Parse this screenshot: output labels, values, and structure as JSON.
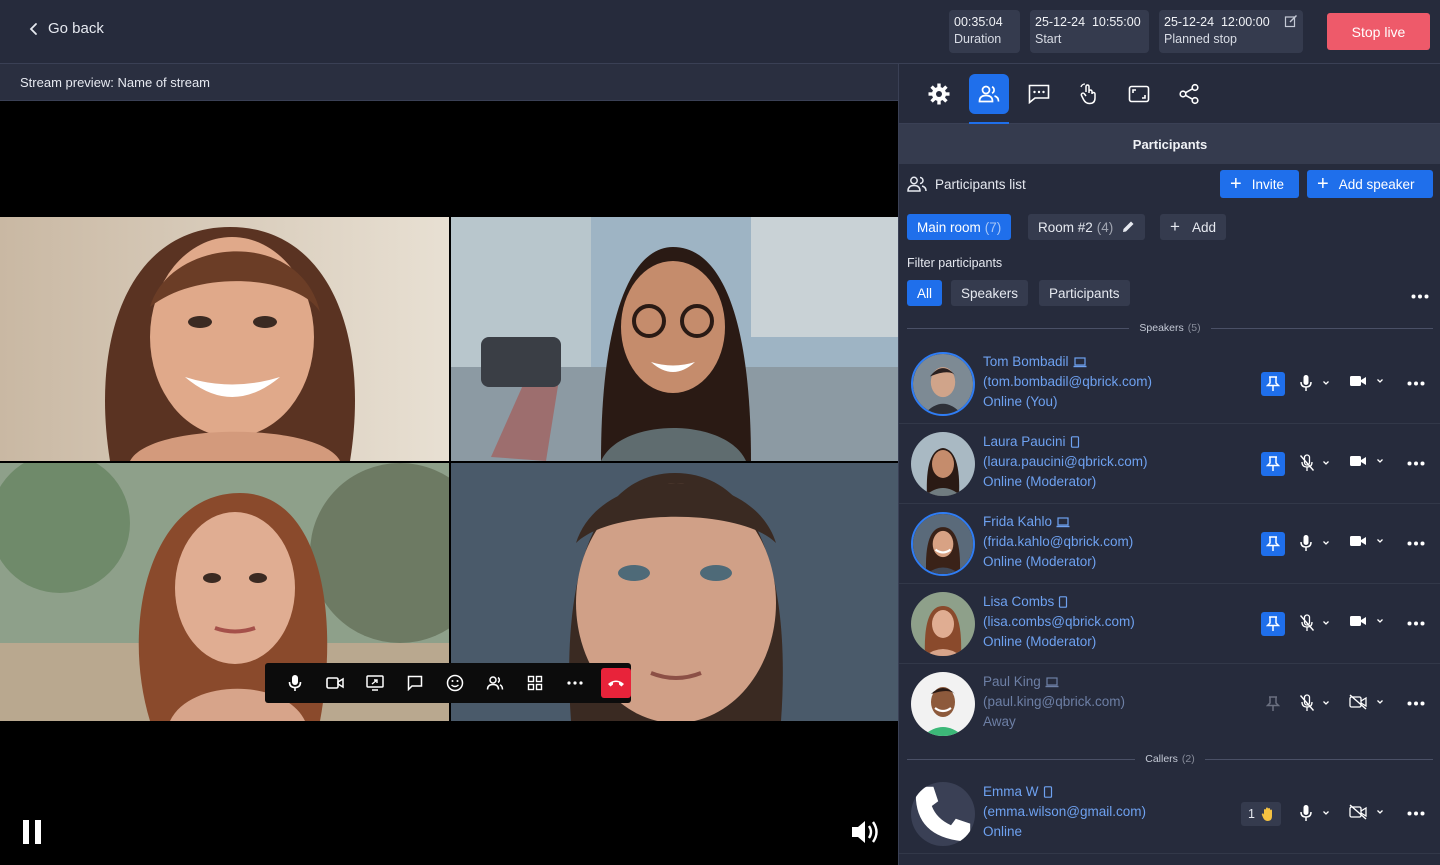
{
  "header": {
    "back_label": "Go back",
    "duration_value": "00:35:04",
    "duration_label": "Duration",
    "start_value": "25-12-24  10:55:00",
    "start_label": "Start",
    "planned_value": "25-12-24  12:00:00",
    "planned_label": "Planned stop",
    "stop_live_label": "Stop live"
  },
  "preview": {
    "title": "Stream preview: Name of stream"
  },
  "panel": {
    "section_title": "Participants",
    "list_label": "Participants list",
    "invite_label": "Invite",
    "add_speaker_label": "Add speaker",
    "rooms": [
      {
        "name": "Main room",
        "count": "(7)"
      },
      {
        "name": "Room #2",
        "count": "(4)"
      }
    ],
    "add_room_label": "Add",
    "filter_label": "Filter participants",
    "filters": [
      "All",
      "Speakers",
      "Participants"
    ],
    "speakers_divider": "Speakers",
    "speakers_count": "(5)",
    "callers_divider": "Callers",
    "callers_count": "(2)",
    "speakers": [
      {
        "name": "Tom Bombadil",
        "email": "(tom.bombadil@qbrick.com)",
        "status": "Online (You)",
        "device": "laptop-icon"
      },
      {
        "name": "Laura Paucini",
        "email": "(laura.paucini@qbrick.com)",
        "status": "Online (Moderator)",
        "device": "phone-icon"
      },
      {
        "name": "Frida Kahlo",
        "email": "(frida.kahlo@qbrick.com)",
        "status": "Online (Moderator)",
        "device": "laptop-icon"
      },
      {
        "name": "Lisa Combs",
        "email": "(lisa.combs@qbrick.com)",
        "status": "Online (Moderator)",
        "device": "phone-icon"
      },
      {
        "name": "Paul King",
        "email": "(paul.king@qbrick.com)",
        "status": "Away",
        "device": "laptop-icon"
      }
    ],
    "callers": [
      {
        "name": "Emma W",
        "email": "(emma.wilson@gmail.com)",
        "status": "Online",
        "hand_count": "1",
        "device": "phone-icon"
      }
    ]
  },
  "colors": {
    "accent": "#1f6feb",
    "stop_live": "#ee5a6a",
    "hangup": "#e8233a",
    "panel_bg": "#262b3c",
    "link_text": "#6ea1f0"
  }
}
